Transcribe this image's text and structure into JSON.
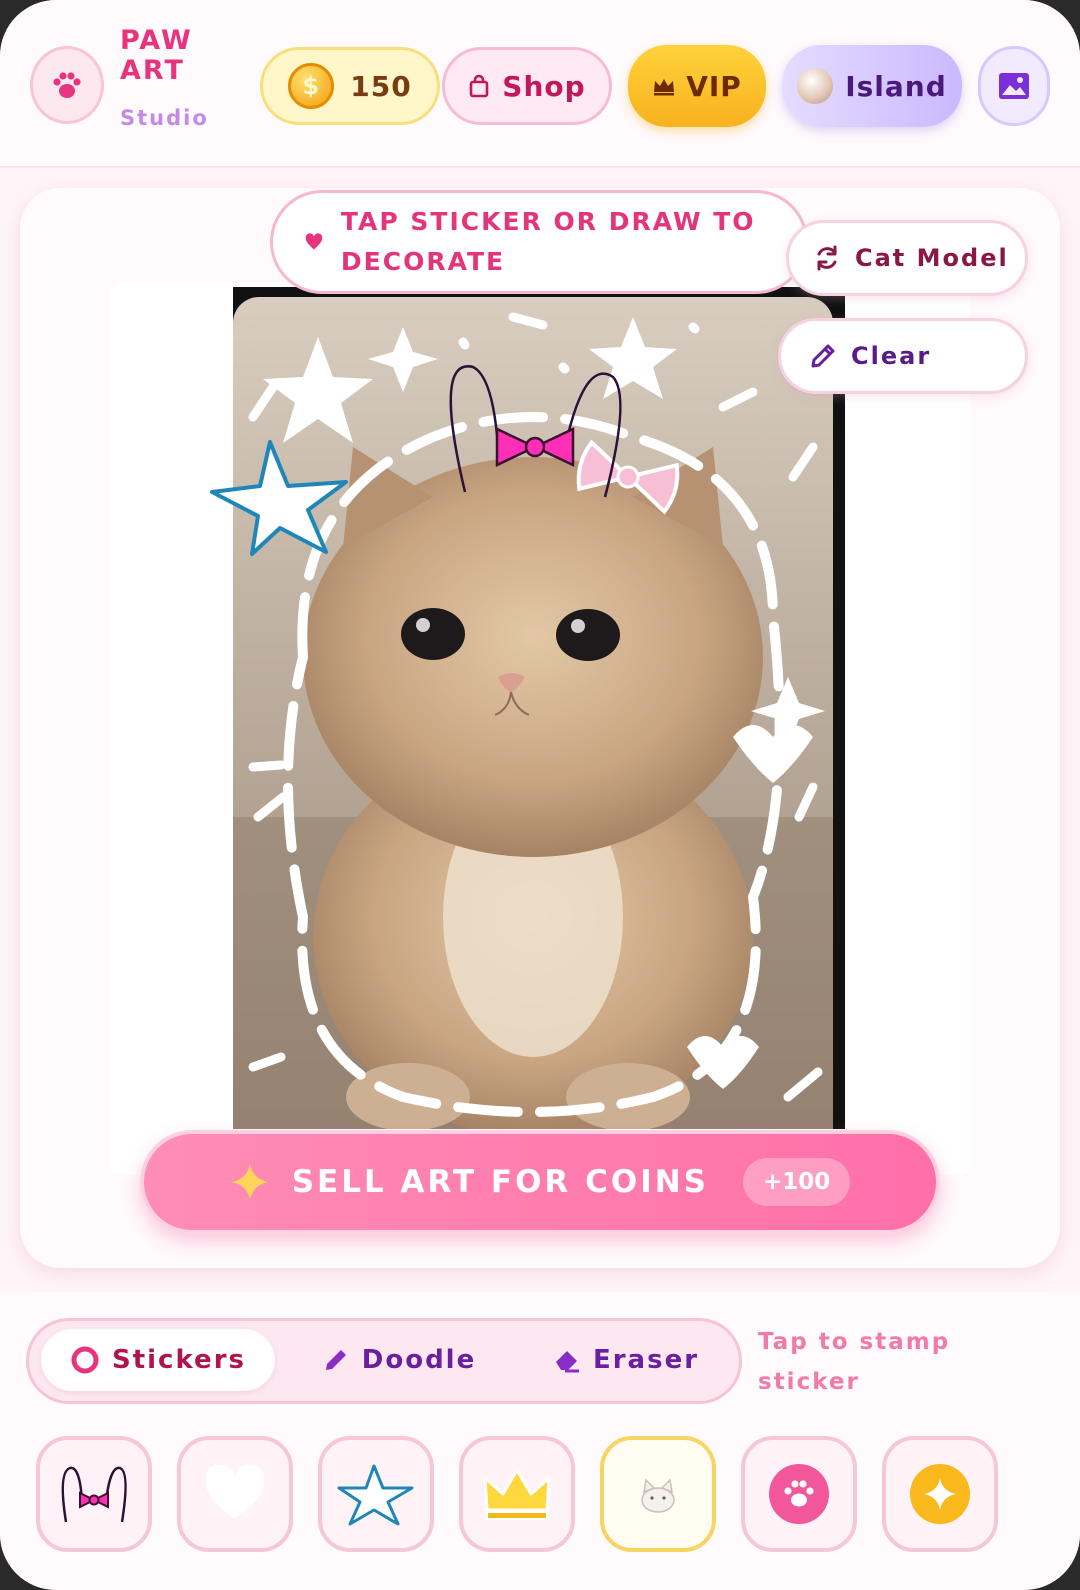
{
  "header": {
    "brand_line1": "PAW",
    "brand_line2": "ART",
    "brand_line3": "Studio",
    "coins": "150",
    "coin_symbol": "$",
    "shop_label": "Shop",
    "vip_label": "VIP",
    "island_label": "Island"
  },
  "canvas": {
    "hint": "TAP STICKER OR DRAW TO DECORATE",
    "cat_model_label": "Cat Model",
    "clear_label": "Clear",
    "sell_label": "SELL ART FOR COINS",
    "sell_reward": "+100"
  },
  "tools": {
    "tabs": [
      {
        "label": "Stickers",
        "icon": "ring-icon",
        "active": true
      },
      {
        "label": "Doodle",
        "icon": "pencil-icon",
        "active": false
      },
      {
        "label": "Eraser",
        "icon": "eraser-icon",
        "active": false
      }
    ],
    "hint": "Tap to stamp sticker",
    "stickers": [
      {
        "icon": "bunny-ears-bow-icon",
        "selected": false
      },
      {
        "icon": "heart-icon",
        "selected": false
      },
      {
        "icon": "star-icon",
        "selected": false
      },
      {
        "icon": "crown-icon",
        "selected": false
      },
      {
        "icon": "cat-icon",
        "selected": true
      },
      {
        "icon": "paw-icon",
        "selected": false
      },
      {
        "icon": "sparkle-icon",
        "selected": false
      }
    ]
  },
  "colors": {
    "brand_pink": "#e8347e",
    "accent_purple": "#6a1ea0",
    "vip_gold": "#f7b21f",
    "sell_pink": "#ff6fa8"
  }
}
